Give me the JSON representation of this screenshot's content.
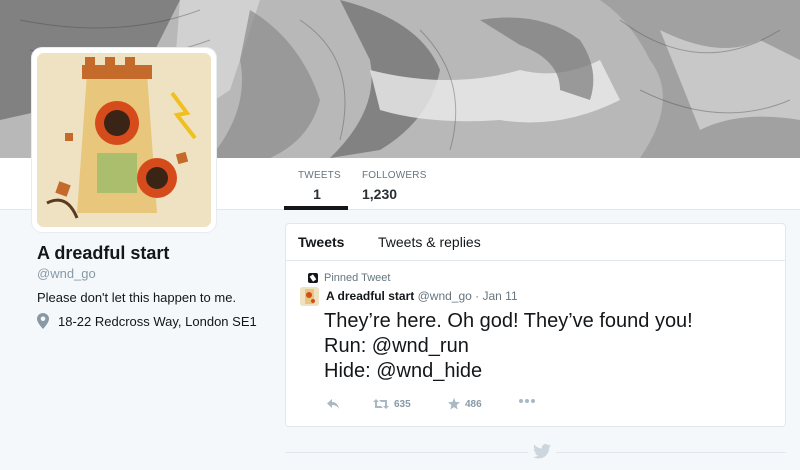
{
  "stats": {
    "tweets_label": "TWEETS",
    "tweets_value": "1",
    "followers_label": "FOLLOWERS",
    "followers_value": "1,230"
  },
  "profile": {
    "name": "A dreadful start",
    "handle": "@wnd_go",
    "bio": "Please don't let this happen to me.",
    "location": "18-22 Redcross Way, London SE1"
  },
  "tabs": {
    "tweets": "Tweets",
    "replies": "Tweets & replies"
  },
  "tweet": {
    "pinned_label": "Pinned Tweet",
    "author": "A dreadful start",
    "meta": "@wnd_go · Jan 11",
    "lines": [
      "They’re here. Oh god! They’ve found you!",
      "Run: @wnd_run",
      "Hide: @wnd_hide"
    ],
    "retweets": "635",
    "likes": "486"
  },
  "icons": {
    "reply": "reply-icon",
    "retweet": "retweet-icon",
    "like": "star-icon",
    "more": "more-icon",
    "location": "location-pin-icon",
    "pinned": "pin-icon",
    "footer": "twitter-bird-icon"
  },
  "colors": {
    "accent": "#14171a",
    "muted": "#8899a6",
    "background": "#f5f8fa"
  }
}
